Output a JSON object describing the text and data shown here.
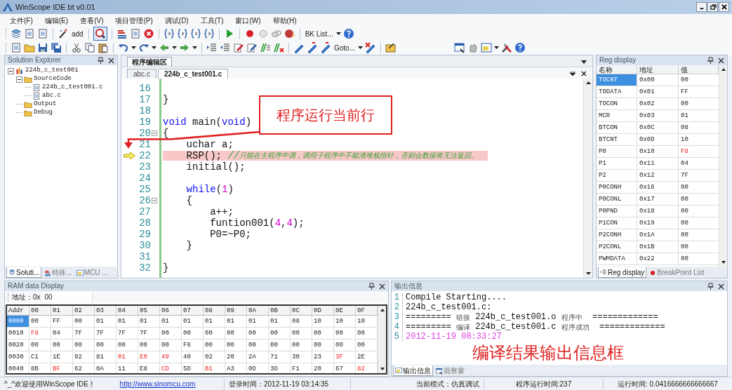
{
  "window": {
    "title": "WinScope IDE bt v0.01"
  },
  "menu": [
    "文件(F)",
    "编辑(E)",
    "查看(V)",
    "项目管理(P)",
    "调试(D)",
    "工具(T)",
    "窗口(W)",
    "帮助(H)"
  ],
  "toolbar": {
    "add_label": "add",
    "bk_list": "BK List...",
    "goto": "Goto..."
  },
  "solution_explorer": {
    "title": "Solution Explorer",
    "tree": [
      {
        "label": "224b_c_test001",
        "kind": "project",
        "expanded": true,
        "children": [
          {
            "label": "SourceCode",
            "kind": "folder",
            "expanded": true,
            "children": [
              {
                "label": "224b_c_test001.c",
                "kind": "file"
              },
              {
                "label": "abc.c",
                "kind": "file"
              }
            ]
          },
          {
            "label": "Output",
            "kind": "folder"
          },
          {
            "label": "Debug",
            "kind": "folder"
          }
        ]
      }
    ],
    "tabs": [
      {
        "label": "Soluti...",
        "selected": true
      },
      {
        "label": "特殊...",
        "selected": false
      },
      {
        "label": "MCU ...",
        "selected": false
      }
    ]
  },
  "editor": {
    "group_tab": "程序编辑区",
    "tabs": [
      {
        "label": "abc.c",
        "selected": false
      },
      {
        "label": "224b_c_test001.c",
        "selected": true
      }
    ],
    "lines": [
      {
        "number": "16",
        "current": false,
        "fold": false
      },
      {
        "number": "17",
        "current": false,
        "fold": false,
        "tokens": [
          {
            "text": "}",
            "kind": "plain"
          }
        ]
      },
      {
        "number": "18",
        "current": false,
        "fold": false
      },
      {
        "number": "19",
        "current": false,
        "fold": false,
        "tokens": [
          {
            "text": "void",
            "kind": "keyword"
          },
          {
            "text": " main(",
            "kind": "plain"
          },
          {
            "text": "void",
            "kind": "keyword"
          },
          {
            "text": ")",
            "kind": "plain"
          }
        ]
      },
      {
        "number": "20",
        "current": false,
        "fold": true,
        "tokens": [
          {
            "text": "{",
            "kind": "plain"
          }
        ]
      },
      {
        "number": "21",
        "current": false,
        "fold": false,
        "tokens": [
          {
            "text": "    uchar a;",
            "kind": "plain"
          }
        ]
      },
      {
        "number": "22",
        "current": true,
        "fold": false,
        "tokens": [
          {
            "text": "    RSP(); ",
            "kind": "plain"
          },
          {
            "text": "//",
            "kind": "comment"
          },
          {
            "text": "只能在主程序中调，调用子程序中不能清堆栈指针，否则会数据将无法返回。",
            "kind": "comment_note"
          }
        ]
      },
      {
        "number": "23",
        "current": false,
        "fold": false,
        "tokens": [
          {
            "text": "    initial();",
            "kind": "plain"
          }
        ]
      },
      {
        "number": "24",
        "current": false,
        "fold": false
      },
      {
        "number": "25",
        "current": false,
        "fold": false,
        "tokens": [
          {
            "text": "    while",
            "kind": "keyword"
          },
          {
            "text": "(",
            "kind": "plain"
          },
          {
            "text": "1",
            "kind": "number"
          },
          {
            "text": ")",
            "kind": "plain"
          }
        ]
      },
      {
        "number": "26",
        "current": false,
        "fold": true,
        "tokens": [
          {
            "text": "    {",
            "kind": "plain"
          }
        ]
      },
      {
        "number": "27",
        "current": false,
        "fold": false,
        "tokens": [
          {
            "text": "        a++;",
            "kind": "plain"
          }
        ]
      },
      {
        "number": "28",
        "current": false,
        "fold": false,
        "tokens": [
          {
            "text": "        funtion001(",
            "kind": "plain"
          },
          {
            "text": "4",
            "kind": "number"
          },
          {
            "text": ",",
            "kind": "plain"
          },
          {
            "text": "4",
            "kind": "number"
          },
          {
            "text": ");",
            "kind": "plain"
          }
        ]
      },
      {
        "number": "29",
        "current": false,
        "fold": false,
        "tokens": [
          {
            "text": "        P0=~P0;",
            "kind": "plain"
          }
        ]
      },
      {
        "number": "30",
        "current": false,
        "fold": false,
        "tokens": [
          {
            "text": "    }",
            "kind": "plain"
          }
        ]
      },
      {
        "number": "31",
        "current": false,
        "fold": false
      },
      {
        "number": "32",
        "current": false,
        "fold": false,
        "tokens": [
          {
            "text": "}",
            "kind": "plain"
          }
        ]
      }
    ],
    "callout": "程序运行当前行"
  },
  "reg_display": {
    "title": "Reg display",
    "columns": [
      "名称",
      "地址",
      "值"
    ],
    "rows": [
      {
        "name": "TOCNT",
        "address": "0x00",
        "value": "00",
        "selected": true,
        "changed": false
      },
      {
        "name": "TODATA",
        "address": "0x01",
        "value": "FF",
        "selected": false,
        "changed": false
      },
      {
        "name": "TOCON",
        "address": "0x02",
        "value": "00",
        "selected": false,
        "changed": false
      },
      {
        "name": "MCR",
        "address": "0x03",
        "value": "01",
        "selected": false,
        "changed": false
      },
      {
        "name": "BTCON",
        "address": "0x0C",
        "value": "08",
        "selected": false,
        "changed": false
      },
      {
        "name": "BTCNT",
        "address": "0x0D",
        "value": "10",
        "selected": false,
        "changed": false
      },
      {
        "name": "P0",
        "address": "0x10",
        "value": "F8",
        "selected": false,
        "changed": true
      },
      {
        "name": "P1",
        "address": "0x11",
        "value": "04",
        "selected": false,
        "changed": false
      },
      {
        "name": "P2",
        "address": "0x12",
        "value": "7F",
        "selected": false,
        "changed": false
      },
      {
        "name": "P0CONH",
        "address": "0x16",
        "value": "00",
        "selected": false,
        "changed": false
      },
      {
        "name": "P0CONL",
        "address": "0x17",
        "value": "00",
        "selected": false,
        "changed": false
      },
      {
        "name": "P0PND",
        "address": "0x18",
        "value": "00",
        "selected": false,
        "changed": false
      },
      {
        "name": "P1CON",
        "address": "0x19",
        "value": "00",
        "selected": false,
        "changed": false
      },
      {
        "name": "P2CONH",
        "address": "0x1A",
        "value": "00",
        "selected": false,
        "changed": false
      },
      {
        "name": "P2CONL",
        "address": "0x1B",
        "value": "00",
        "selected": false,
        "changed": false
      },
      {
        "name": "PWMDATA",
        "address": "0x22",
        "value": "00",
        "selected": false,
        "changed": false
      }
    ],
    "tabs": [
      {
        "label": "Reg display",
        "selected": true
      },
      {
        "label": "BreakPoint List",
        "selected": false
      }
    ]
  },
  "ram_display": {
    "title": "RAM data Display",
    "address_label": "地址：0x",
    "address_value": "00",
    "columns": [
      "Addr",
      "00",
      "01",
      "02",
      "03",
      "04",
      "05",
      "06",
      "07",
      "08",
      "09",
      "0A",
      "0B",
      "0C",
      "0D",
      "0E",
      "0F"
    ],
    "rows": [
      {
        "selected": true,
        "cells": [
          {
            "value": "0000",
            "changed": false
          },
          {
            "value": "00",
            "changed": false
          },
          {
            "value": "FF",
            "changed": false
          },
          {
            "value": "00",
            "changed": false
          },
          {
            "value": "01",
            "changed": false
          },
          {
            "value": "01",
            "changed": false
          },
          {
            "value": "01",
            "changed": false
          },
          {
            "value": "01",
            "changed": false
          },
          {
            "value": "01",
            "changed": false
          },
          {
            "value": "01",
            "changed": false
          },
          {
            "value": "01",
            "changed": false
          },
          {
            "value": "01",
            "changed": false
          },
          {
            "value": "01",
            "changed": false
          },
          {
            "value": "08",
            "changed": false
          },
          {
            "value": "10",
            "changed": false
          },
          {
            "value": "10",
            "changed": false
          },
          {
            "value": "10",
            "changed": false
          }
        ]
      },
      {
        "selected": false,
        "cells": [
          {
            "value": "0010",
            "changed": false
          },
          {
            "value": "F8",
            "changed": true
          },
          {
            "value": "04",
            "changed": false
          },
          {
            "value": "7F",
            "changed": false
          },
          {
            "value": "7F",
            "changed": false
          },
          {
            "value": "7F",
            "changed": false
          },
          {
            "value": "7F",
            "changed": false
          },
          {
            "value": "00",
            "changed": false
          },
          {
            "value": "00",
            "changed": false
          },
          {
            "value": "00",
            "changed": false
          },
          {
            "value": "00",
            "changed": false
          },
          {
            "value": "00",
            "changed": false
          },
          {
            "value": "00",
            "changed": false
          },
          {
            "value": "00",
            "changed": false
          },
          {
            "value": "00",
            "changed": false
          },
          {
            "value": "00",
            "changed": false
          },
          {
            "value": "00",
            "changed": false
          }
        ]
      },
      {
        "selected": false,
        "cells": [
          {
            "value": "0020",
            "changed": false
          },
          {
            "value": "00",
            "changed": false
          },
          {
            "value": "00",
            "changed": false
          },
          {
            "value": "00",
            "changed": false
          },
          {
            "value": "00",
            "changed": false
          },
          {
            "value": "00",
            "changed": false
          },
          {
            "value": "00",
            "changed": false
          },
          {
            "value": "00",
            "changed": false
          },
          {
            "value": "F6",
            "changed": false
          },
          {
            "value": "00",
            "changed": false
          },
          {
            "value": "00",
            "changed": false
          },
          {
            "value": "00",
            "changed": false
          },
          {
            "value": "00",
            "changed": false
          },
          {
            "value": "00",
            "changed": false
          },
          {
            "value": "00",
            "changed": false
          },
          {
            "value": "00",
            "changed": false
          },
          {
            "value": "00",
            "changed": false
          }
        ]
      },
      {
        "selected": false,
        "cells": [
          {
            "value": "0030",
            "changed": false
          },
          {
            "value": "C1",
            "changed": false
          },
          {
            "value": "1E",
            "changed": false
          },
          {
            "value": "92",
            "changed": false
          },
          {
            "value": "81",
            "changed": false
          },
          {
            "value": "01",
            "changed": true
          },
          {
            "value": "E0",
            "changed": true
          },
          {
            "value": "49",
            "changed": true
          },
          {
            "value": "40",
            "changed": false
          },
          {
            "value": "02",
            "changed": false
          },
          {
            "value": "20",
            "changed": false
          },
          {
            "value": "2A",
            "changed": false
          },
          {
            "value": "71",
            "changed": false
          },
          {
            "value": "30",
            "changed": false
          },
          {
            "value": "23",
            "changed": false
          },
          {
            "value": "3F",
            "changed": true
          },
          {
            "value": "2E",
            "changed": false
          }
        ]
      },
      {
        "selected": false,
        "cells": [
          {
            "value": "0040",
            "changed": false
          },
          {
            "value": "8B",
            "changed": false
          },
          {
            "value": "BF",
            "changed": true
          },
          {
            "value": "62",
            "changed": false
          },
          {
            "value": "0A",
            "changed": false
          },
          {
            "value": "11",
            "changed": false
          },
          {
            "value": "E8",
            "changed": false
          },
          {
            "value": "CD",
            "changed": true
          },
          {
            "value": "5D",
            "changed": false
          },
          {
            "value": "B1",
            "changed": true
          },
          {
            "value": "A3",
            "changed": false
          },
          {
            "value": "0D",
            "changed": false
          },
          {
            "value": "3D",
            "changed": false
          },
          {
            "value": "F1",
            "changed": false
          },
          {
            "value": "20",
            "changed": false
          },
          {
            "value": "67",
            "changed": false
          },
          {
            "value": "82",
            "changed": true
          }
        ]
      }
    ]
  },
  "output": {
    "title": "输出信息",
    "lines": [
      {
        "number": "1",
        "segments": [
          {
            "text": "Compile Starting....",
            "kind": "plain"
          }
        ]
      },
      {
        "number": "2",
        "segments": [
          {
            "text": "224b_c_test001.c:",
            "kind": "plain"
          }
        ]
      },
      {
        "number": "3",
        "segments": [
          {
            "text": "========= ",
            "kind": "plain"
          },
          {
            "text": "链接",
            "kind": "note"
          },
          {
            "text": " 224b_c_test001.o ",
            "kind": "plain"
          },
          {
            "text": "程序中",
            "kind": "note"
          },
          {
            "text": "  =============",
            "kind": "plain"
          }
        ]
      },
      {
        "number": "4",
        "segments": [
          {
            "text": "========= ",
            "kind": "plain"
          },
          {
            "text": "编译",
            "kind": "note"
          },
          {
            "text": " 224b_c_test001.c ",
            "kind": "plain"
          },
          {
            "text": "程序成功",
            "kind": "note"
          },
          {
            "text": "  =============",
            "kind": "plain"
          }
        ]
      },
      {
        "number": "5",
        "segments": [
          {
            "text": "2012-11-19 08:33:27",
            "kind": "date"
          }
        ]
      }
    ],
    "caption": "编译结果输出信息框",
    "tabs": [
      {
        "label": "输出信息",
        "selected": true
      },
      {
        "label": "观察窗",
        "selected": false
      }
    ]
  },
  "status_bar": {
    "welcome": "^_^欢迎使用WinScope IDE！",
    "link": "http://www.sinomcu.com",
    "login_time": "登录时间：2012-11-19 03:14:35",
    "mode": "当前模式：仿真调试",
    "program_run_time": "程序运行时间:237",
    "run_time": "运行时间: 0.0416666666666667"
  }
}
